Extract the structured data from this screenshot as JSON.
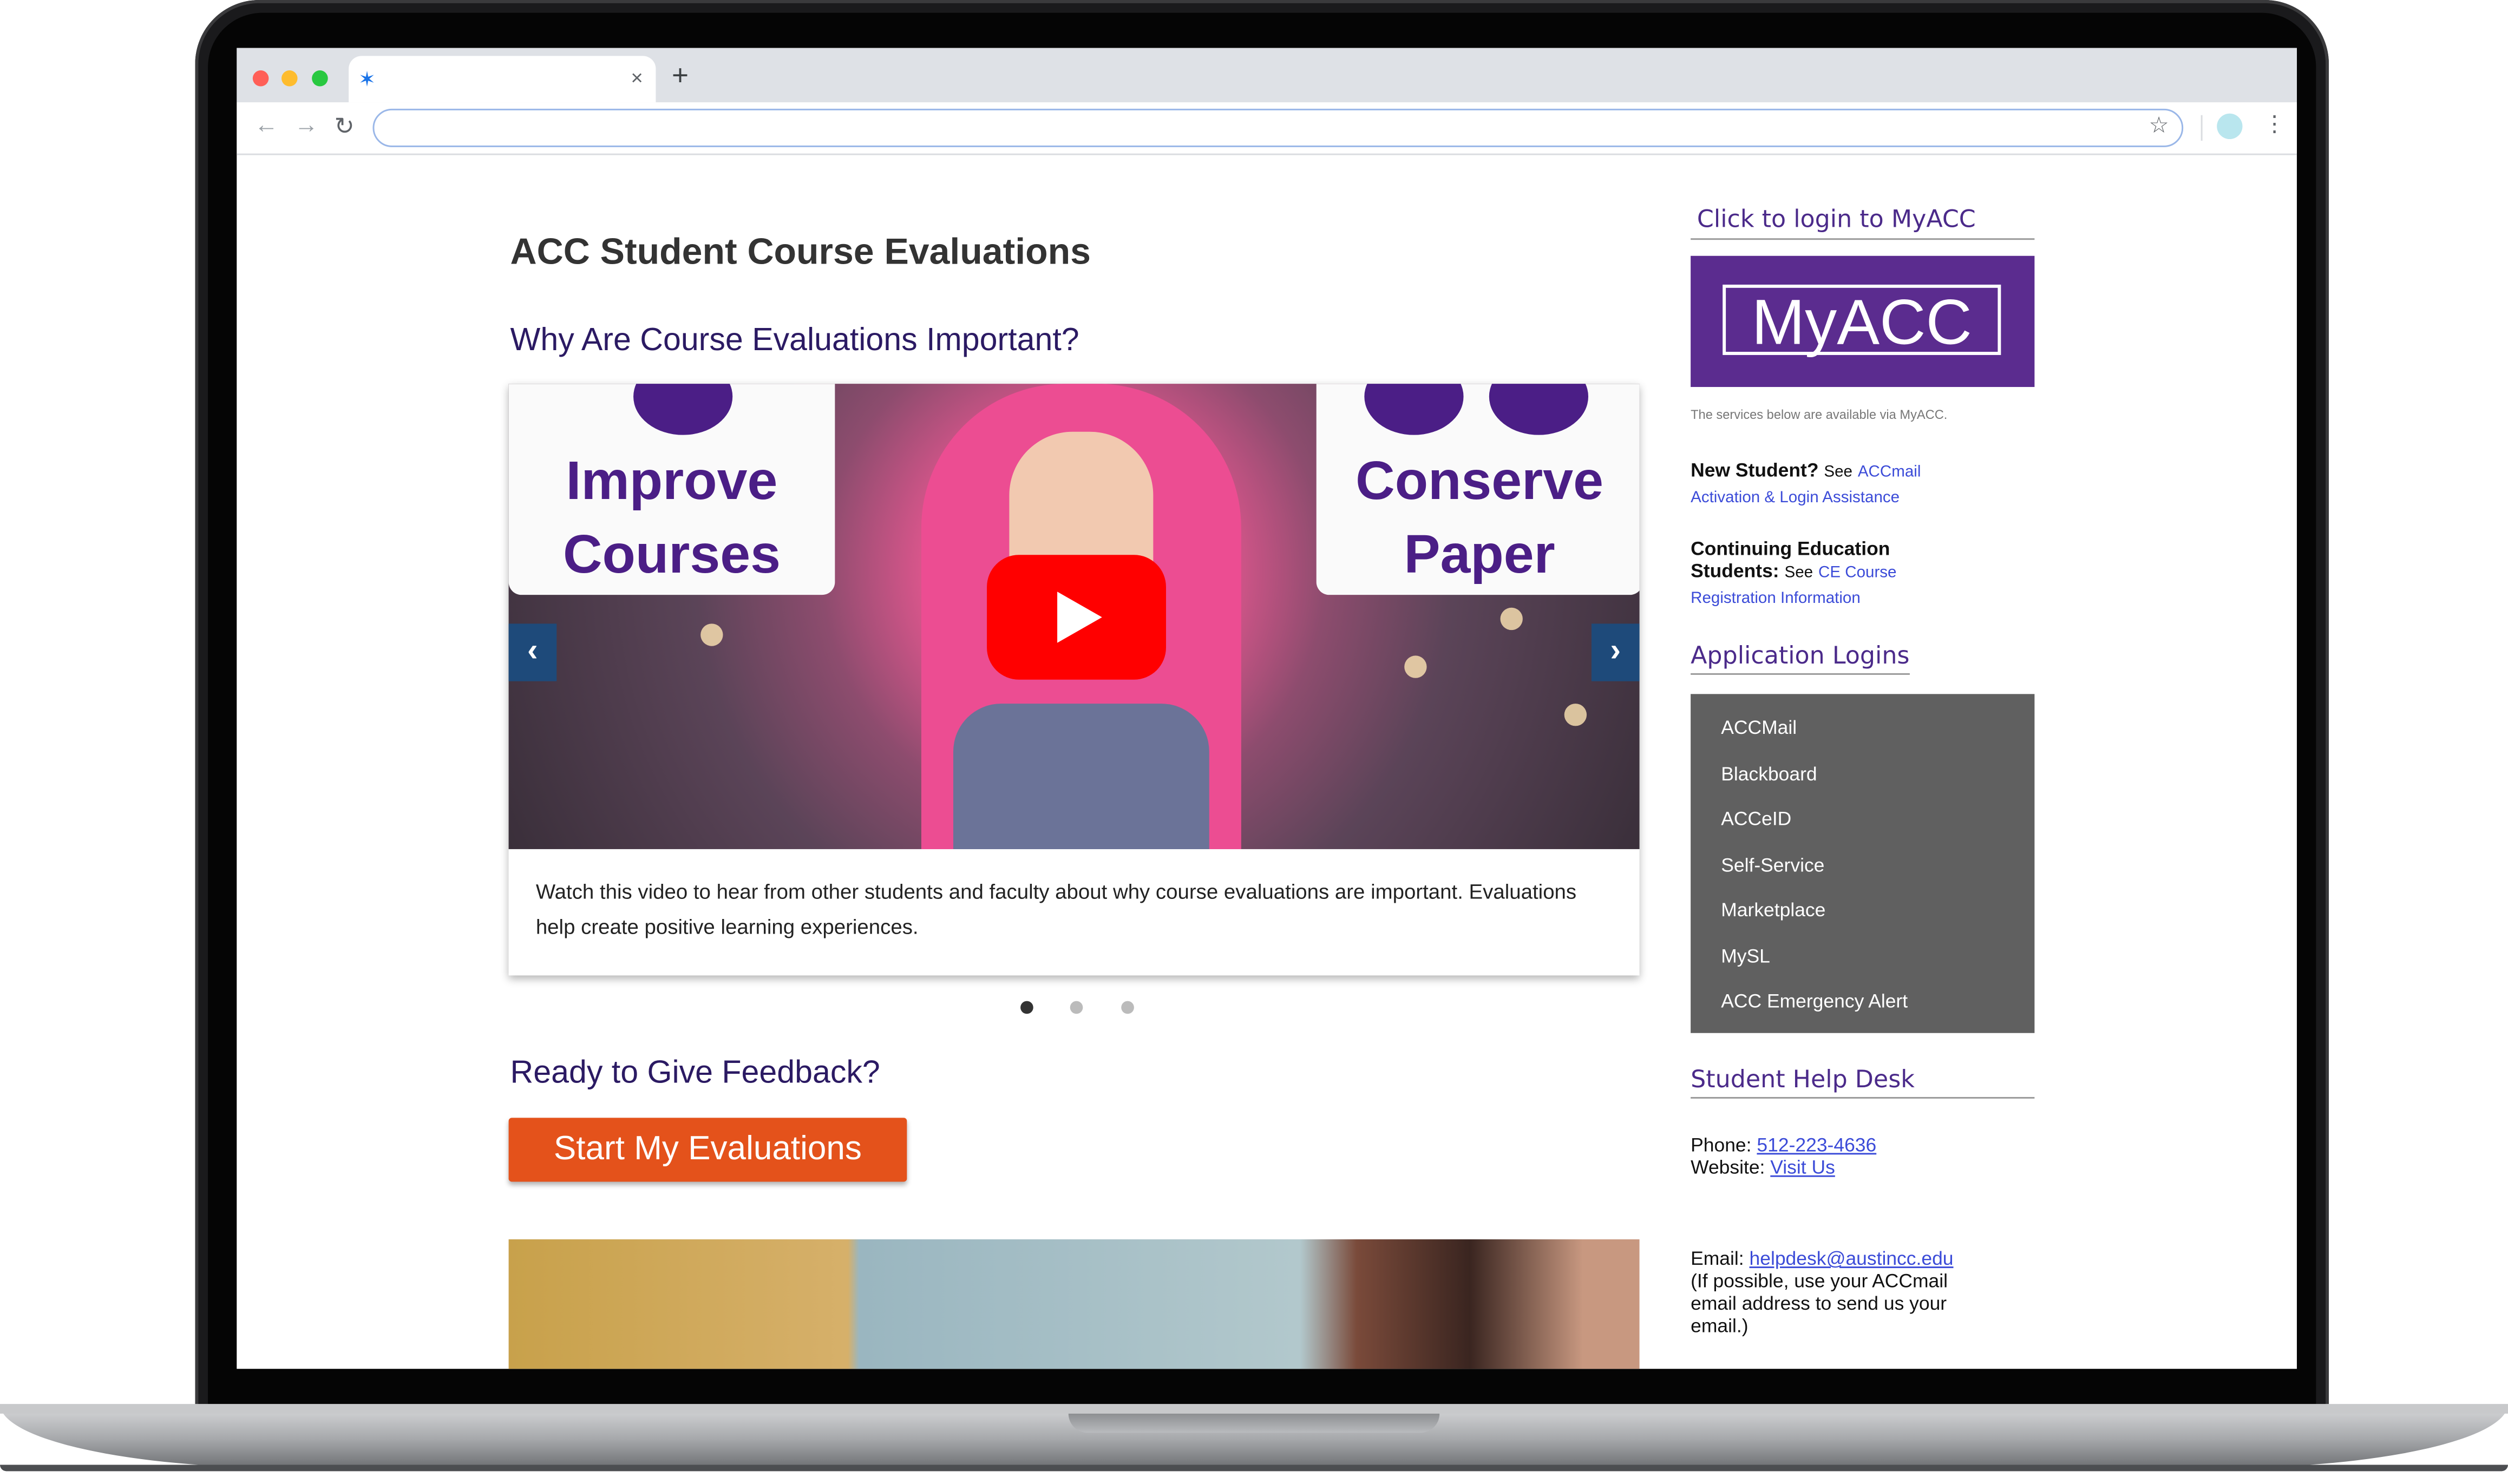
{
  "browser": {
    "tab_close": "×",
    "new_tab": "+",
    "back": "←",
    "forward": "→",
    "reload": "↻",
    "address_value": "",
    "bookmark_star": "☆",
    "menu": "⋮"
  },
  "page": {
    "title": "ACC Student Course Evaluations",
    "why_heading": "Why Are Course Evaluations Important?",
    "carousel": {
      "sign_left": "Improve Courses",
      "sign_right": "Conserve Paper",
      "prev": "‹",
      "next": "›",
      "caption": "Watch this video to hear from other students and faculty about why course evaluations are important. Evaluations help create positive learning experiences.",
      "active_slide": 1,
      "slide_count": 3
    },
    "ready_heading": "Ready to Give Feedback?",
    "cta_label": "Start My Evaluations"
  },
  "sidebar": {
    "login_heading": "Click to login to MyACC",
    "myacc_logo": "MyACC",
    "services_note": "The services below are available via MyACC.",
    "new_student_label": "New Student?",
    "new_student_see": "See",
    "new_student_link": "ACCmail Activation & Login Assistance",
    "ce_label": "Continuing Education Students:",
    "ce_see": "See",
    "ce_link": "CE Course Registration Information",
    "app_logins_heading": "Application Logins",
    "app_logins": [
      "ACCMail",
      "Blackboard",
      "ACCeID",
      "Self-Service",
      "Marketplace",
      "MySL",
      "ACC Emergency Alert"
    ],
    "help_heading": "Student Help Desk",
    "phone_label": "Phone:",
    "phone_value": "512-223-4636",
    "website_label": "Website:",
    "website_value": "Visit Us",
    "email_label": "Email:",
    "email_value": "helpdesk@austincc.edu",
    "email_note": "(If possible, use your ACCmail email address to send us your email.)"
  },
  "colors": {
    "cta": "#e4521b",
    "heading_purple": "#2b1a63",
    "myacc_purple": "#5b2c8f",
    "login_panel": "#606060",
    "carousel_arrow": "#1e4a7a",
    "youtube_red": "#ff0000"
  }
}
